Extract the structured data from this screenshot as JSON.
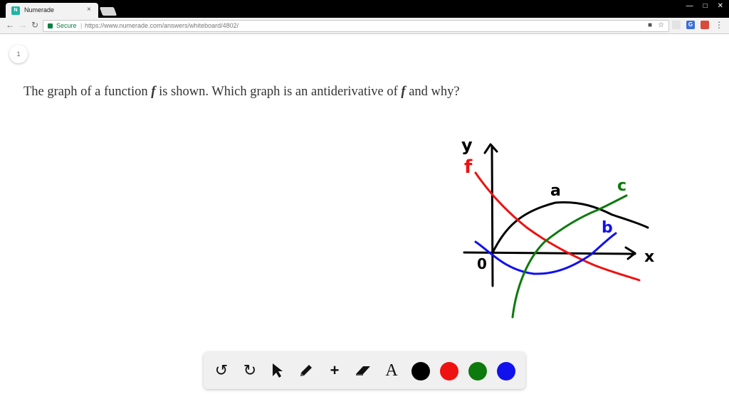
{
  "browser": {
    "tab_title": "Numerade",
    "tab_close": "×",
    "favicon_text": "N",
    "secure_label": "Secure",
    "url": "https://www.numerade.com/answers/whiteboard/4802/"
  },
  "page": {
    "badge": "1",
    "question_parts": [
      "The graph of a function ",
      "f",
      " is shown. Which graph is an antiderivative of ",
      "f",
      " and why?"
    ]
  },
  "sketch": {
    "labels": {
      "y_axis": "y",
      "x_axis": "x",
      "origin": "0",
      "f": "f",
      "a": "a",
      "b": "b",
      "c": "c"
    },
    "colors": {
      "black": "#000000",
      "red": "#ee1111",
      "green": "#0d7a0d",
      "blue": "#1111ee"
    }
  },
  "toolbar": {
    "tools": [
      "undo-icon",
      "redo-icon",
      "pointer-icon",
      "pencil-icon",
      "plus-icon",
      "eraser-icon",
      "text-icon"
    ],
    "text_tool_label": "A",
    "swatches": [
      "#000000",
      "#ee1111",
      "#0d7a0d",
      "#1111ee"
    ]
  }
}
